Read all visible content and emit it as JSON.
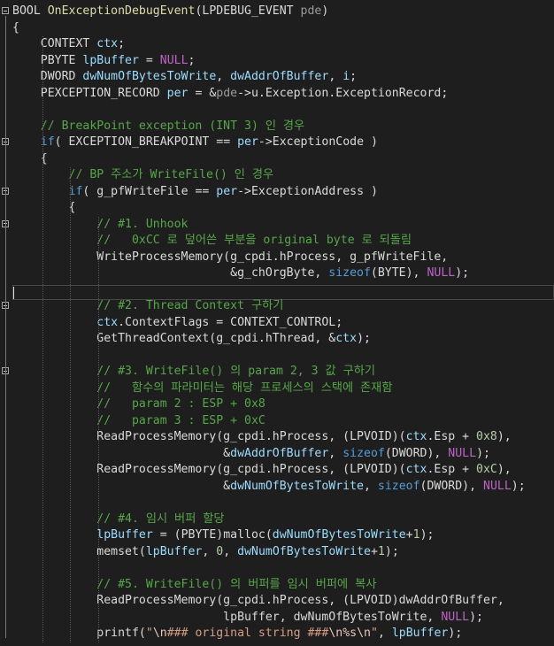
{
  "editor": {
    "language": "C",
    "colors": {
      "background": "#1e1e1e",
      "keyword": "#569cd6",
      "function": "#dcdcaa",
      "local_variable": "#9cdcfe",
      "macro": "#bd63c5",
      "number": "#b5cea8",
      "string": "#d69d85",
      "comment": "#57a64a",
      "parameter": "#9a9a9a"
    },
    "lines": [
      {
        "fold": true,
        "tokens": [
          [
            "BOOL ",
            "md"
          ],
          [
            "OnExceptionDebugEvent",
            "fn"
          ],
          [
            "(LPDEBUG_EVENT ",
            "md"
          ],
          [
            "pde",
            "pr"
          ],
          [
            ")",
            "md"
          ]
        ]
      },
      {
        "tokens": [
          [
            "{",
            "md"
          ]
        ]
      },
      {
        "tokens": [
          [
            "    CONTEXT ",
            "md"
          ],
          [
            "ctx",
            "lv"
          ],
          [
            ";",
            "md"
          ]
        ]
      },
      {
        "tokens": [
          [
            "    PBYTE ",
            "md"
          ],
          [
            "lpBuffer",
            "lv"
          ],
          [
            " = ",
            "md"
          ],
          [
            "NULL",
            "mc"
          ],
          [
            ";",
            "md"
          ]
        ]
      },
      {
        "tokens": [
          [
            "    DWORD ",
            "md"
          ],
          [
            "dwNumOfBytesToWrite",
            "lv"
          ],
          [
            ", ",
            "md"
          ],
          [
            "dwAddrOfBuffer",
            "lv"
          ],
          [
            ", ",
            "md"
          ],
          [
            "i",
            "lv"
          ],
          [
            ";",
            "md"
          ]
        ]
      },
      {
        "tokens": [
          [
            "    PEXCEPTION_RECORD ",
            "md"
          ],
          [
            "per",
            "lv"
          ],
          [
            " = &",
            "md"
          ],
          [
            "pde",
            "pr"
          ],
          [
            "->u.Exception.ExceptionRecord;",
            "md"
          ]
        ]
      },
      {
        "tokens": []
      },
      {
        "tokens": [
          [
            "    // BreakPoint exception (INT 3) 인 경우",
            "cm"
          ]
        ]
      },
      {
        "fold": true,
        "tokens": [
          [
            "    ",
            "md"
          ],
          [
            "if",
            "kw"
          ],
          [
            "( EXCEPTION_BREAKPOINT == ",
            "md"
          ],
          [
            "per",
            "lv"
          ],
          [
            "->ExceptionCode )",
            "md"
          ]
        ]
      },
      {
        "tokens": [
          [
            "    {",
            "md"
          ]
        ]
      },
      {
        "tokens": [
          [
            "        // BP 주소가 WriteFile() 인 경우",
            "cm"
          ]
        ]
      },
      {
        "fold": true,
        "tokens": [
          [
            "        ",
            "md"
          ],
          [
            "if",
            "kw"
          ],
          [
            "( g_pfWriteFile == ",
            "md"
          ],
          [
            "per",
            "lv"
          ],
          [
            "->ExceptionAddress )",
            "md"
          ]
        ]
      },
      {
        "tokens": [
          [
            "        {",
            "md"
          ]
        ]
      },
      {
        "fold": true,
        "tokens": [
          [
            "            // #1. Unhook",
            "cm"
          ]
        ]
      },
      {
        "tokens": [
          [
            "            //   0xCC 로 덮어쓴 부분을 original byte 로 되돌림",
            "cm"
          ]
        ]
      },
      {
        "tokens": [
          [
            "            WriteProcessMemory(g_cpdi.hProcess, g_pfWriteFile,",
            "md"
          ]
        ]
      },
      {
        "tokens": [
          [
            "                               &g_chOrgByte, ",
            "md"
          ],
          [
            "sizeof",
            "kw"
          ],
          [
            "(BYTE), ",
            "md"
          ],
          [
            "NULL",
            "mc"
          ],
          [
            ");",
            "md"
          ]
        ]
      },
      {
        "tokens": []
      },
      {
        "fold": true,
        "tokens": [
          [
            "            // #2. Thread Context 구하기",
            "cm"
          ]
        ]
      },
      {
        "tokens": [
          [
            "            ",
            "md"
          ],
          [
            "ctx",
            "lv"
          ],
          [
            ".ContextFlags = CONTEXT_CONTROL;",
            "md"
          ]
        ]
      },
      {
        "tokens": [
          [
            "            GetThreadContext(g_cpdi.hThread, &",
            "md"
          ],
          [
            "ctx",
            "lv"
          ],
          [
            ");",
            "md"
          ]
        ]
      },
      {
        "tokens": []
      },
      {
        "fold": true,
        "tokens": [
          [
            "            // #3. WriteFile() 의 param 2, 3 값 구하기",
            "cm"
          ]
        ]
      },
      {
        "tokens": [
          [
            "            //   함수의 파라미터는 해당 프로세스의 스택에 존재함",
            "cm"
          ]
        ]
      },
      {
        "tokens": [
          [
            "            //   param 2 : ESP + 0x8",
            "cm"
          ]
        ]
      },
      {
        "tokens": [
          [
            "            //   param 3 : ESP + 0xC",
            "cm"
          ]
        ]
      },
      {
        "tokens": [
          [
            "            ReadProcessMemory(g_cpdi.hProcess, (LPVOID)(",
            "md"
          ],
          [
            "ctx",
            "lv"
          ],
          [
            ".Esp + ",
            "md"
          ],
          [
            "0x8",
            "nm"
          ],
          [
            "),",
            "md"
          ]
        ]
      },
      {
        "tokens": [
          [
            "                              &",
            "md"
          ],
          [
            "dwAddrOfBuffer",
            "lv"
          ],
          [
            ", ",
            "md"
          ],
          [
            "sizeof",
            "kw"
          ],
          [
            "(DWORD), ",
            "md"
          ],
          [
            "NULL",
            "mc"
          ],
          [
            ");",
            "md"
          ]
        ]
      },
      {
        "tokens": [
          [
            "            ReadProcessMemory(g_cpdi.hProcess, (LPVOID)(",
            "md"
          ],
          [
            "ctx",
            "lv"
          ],
          [
            ".Esp + ",
            "md"
          ],
          [
            "0xC",
            "nm"
          ],
          [
            "),",
            "md"
          ]
        ]
      },
      {
        "tokens": [
          [
            "                              &",
            "md"
          ],
          [
            "dwNumOfBytesToWrite",
            "lv"
          ],
          [
            ", ",
            "md"
          ],
          [
            "sizeof",
            "kw"
          ],
          [
            "(DWORD), ",
            "md"
          ],
          [
            "NULL",
            "mc"
          ],
          [
            ");",
            "md"
          ]
        ]
      },
      {
        "tokens": []
      },
      {
        "tokens": [
          [
            "            // #4. 임시 버퍼 할당",
            "cm"
          ]
        ]
      },
      {
        "tokens": [
          [
            "            ",
            "md"
          ],
          [
            "lpBuffer",
            "lv"
          ],
          [
            " = (PBYTE)malloc(",
            "md"
          ],
          [
            "dwNumOfBytesToWrite",
            "lv"
          ],
          [
            "+",
            "md"
          ],
          [
            "1",
            "nm"
          ],
          [
            ");",
            "md"
          ]
        ]
      },
      {
        "tokens": [
          [
            "            memset(",
            "md"
          ],
          [
            "lpBuffer",
            "lv"
          ],
          [
            ", ",
            "md"
          ],
          [
            "0",
            "nm"
          ],
          [
            ", ",
            "md"
          ],
          [
            "dwNumOfBytesToWrite",
            "lv"
          ],
          [
            "+",
            "md"
          ],
          [
            "1",
            "nm"
          ],
          [
            ");",
            "md"
          ]
        ]
      },
      {
        "tokens": []
      },
      {
        "tokens": [
          [
            "            // #5. WriteFile() 의 버퍼를 임시 버퍼에 복사",
            "cm"
          ]
        ]
      },
      {
        "tokens": [
          [
            "            ReadProcessMemory(g_cpdi.hProcess, (LPVOID)dwAddrOfBuffer,",
            "md"
          ]
        ]
      },
      {
        "tokens": [
          [
            "                              lpBuffer, dwNumOfBytesToWrite, ",
            "md"
          ],
          [
            "NULL",
            "mc"
          ],
          [
            ");",
            "md"
          ]
        ]
      },
      {
        "tokens": [
          [
            "            printf(",
            "md"
          ],
          [
            "\"",
            "st"
          ],
          [
            "\\n",
            "es"
          ],
          [
            "### original string ###",
            "st"
          ],
          [
            "\\n",
            "es"
          ],
          [
            "%s",
            "es"
          ],
          [
            "\\n",
            "es"
          ],
          [
            "\"",
            "st"
          ],
          [
            ", ",
            "md"
          ],
          [
            "lpBuffer",
            "lv"
          ],
          [
            ");",
            "md"
          ]
        ]
      }
    ]
  }
}
